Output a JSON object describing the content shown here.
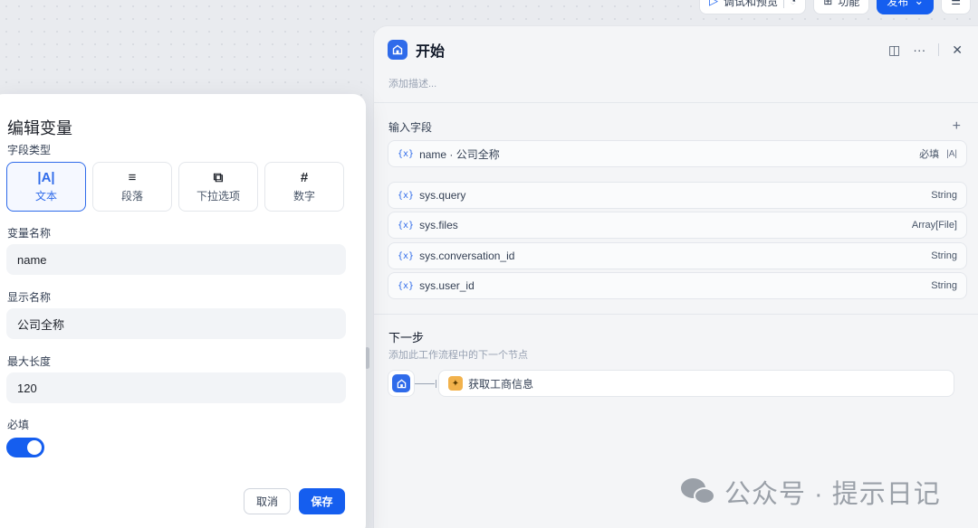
{
  "toolbar": {
    "debug_label": "调试和预览",
    "features_label": "功能",
    "publish_label": "发布"
  },
  "start_node": {
    "title": "开始",
    "description_placeholder": "添加描述...",
    "input_section_title": "输入字段",
    "fields": [
      {
        "var_icon": "{x}",
        "name": "name · 公司全称",
        "required_label": "必填",
        "type_glyph": "|A|"
      }
    ],
    "system_vars": [
      {
        "var_icon": "{x}",
        "name": "sys.query",
        "type": "String"
      },
      {
        "var_icon": "{x}",
        "name": "sys.files",
        "type": "Array[File]"
      },
      {
        "var_icon": "{x}",
        "name": "sys.conversation_id",
        "type": "String"
      },
      {
        "var_icon": "{x}",
        "name": "sys.user_id",
        "type": "String"
      }
    ],
    "next_step": {
      "title": "下一步",
      "description": "添加此工作流程中的下一个节点",
      "target_node": "获取工商信息"
    }
  },
  "watermark": {
    "text": "公众号 · 提示日记"
  },
  "edit_variable": {
    "title": "编辑变量",
    "field_type_label": "字段类型",
    "field_types": [
      {
        "icon": "|A|",
        "label": "文本",
        "active": true
      },
      {
        "icon": "≡",
        "label": "段落",
        "active": false
      },
      {
        "icon": "⧉",
        "label": "下拉选项",
        "active": false
      },
      {
        "icon": "#",
        "label": "数字",
        "active": false
      }
    ],
    "variable_name_label": "变量名称",
    "variable_name_value": "name",
    "display_name_label": "显示名称",
    "display_name_value": "公司全称",
    "max_length_label": "最大长度",
    "max_length_value": "120",
    "required_label": "必填",
    "required_on": true,
    "cancel_label": "取消",
    "save_label": "保存"
  },
  "colors": {
    "accent": "#155eef",
    "node_icon": "#2f6bea"
  }
}
